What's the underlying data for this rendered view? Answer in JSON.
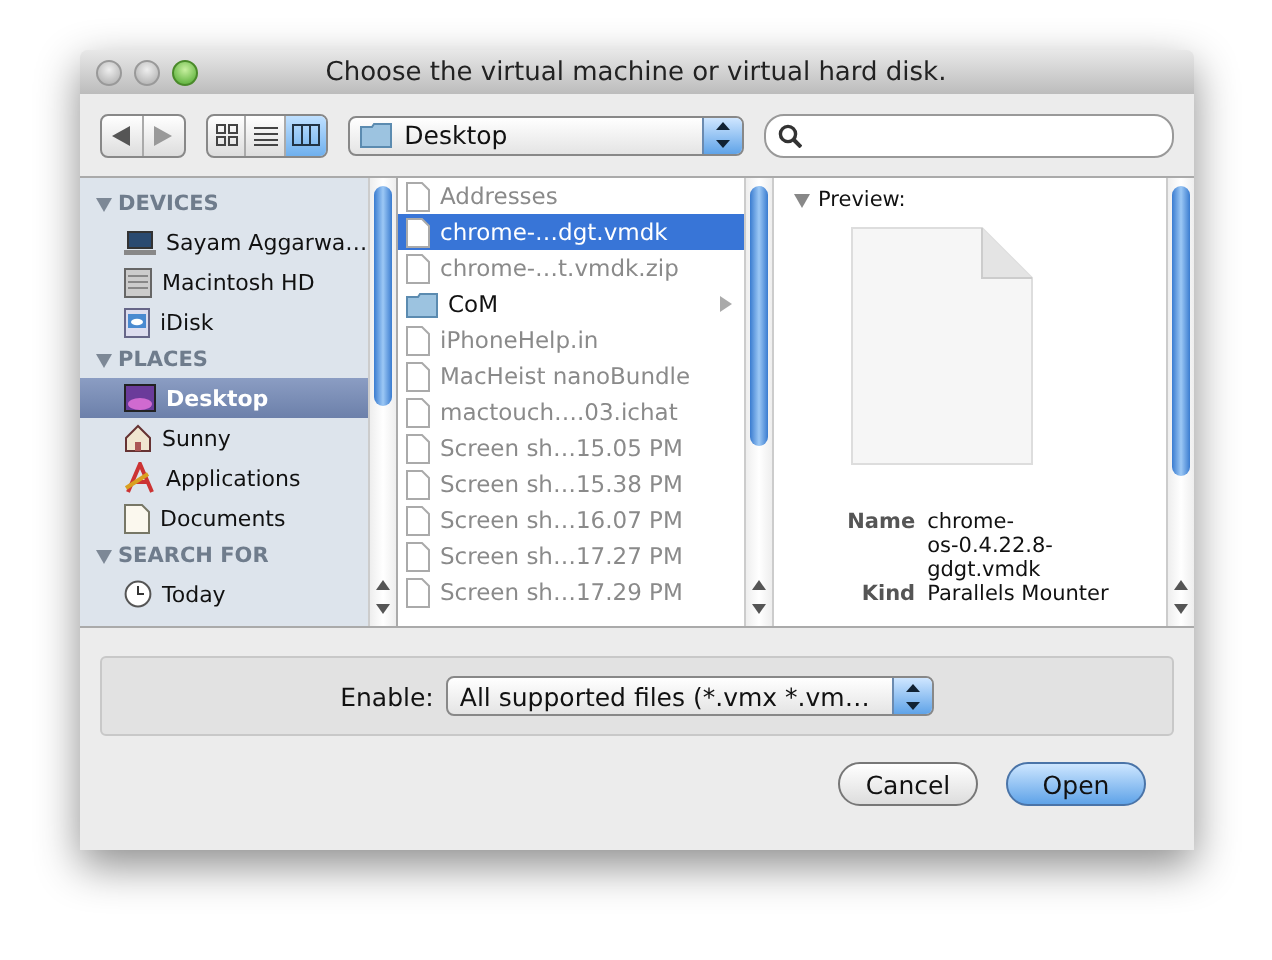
{
  "window": {
    "title": "Choose the virtual machine or virtual hard disk."
  },
  "toolbar": {
    "view_modes": [
      {
        "kind": "icon",
        "selected": false
      },
      {
        "kind": "list",
        "selected": false
      },
      {
        "kind": "column",
        "selected": true
      }
    ],
    "location": "Desktop"
  },
  "sidebar": {
    "sections": [
      {
        "heading": "DEVICES",
        "items": [
          {
            "label": "Sayam Aggarwa…",
            "kind": "laptop",
            "selected": false
          },
          {
            "label": "Macintosh HD",
            "kind": "drive",
            "selected": false
          },
          {
            "label": "iDisk",
            "kind": "idisk",
            "selected": false
          }
        ]
      },
      {
        "heading": "PLACES",
        "items": [
          {
            "label": "Desktop",
            "kind": "desktop",
            "selected": true
          },
          {
            "label": "Sunny",
            "kind": "home",
            "selected": false
          },
          {
            "label": "Applications",
            "kind": "apps",
            "selected": false
          },
          {
            "label": "Documents",
            "kind": "documents",
            "selected": false
          }
        ]
      },
      {
        "heading": "SEARCH FOR",
        "items": [
          {
            "label": "Today",
            "kind": "clock",
            "selected": false
          }
        ]
      }
    ]
  },
  "files": [
    {
      "name": "Addresses",
      "kind": "file",
      "disabled": true,
      "selected": false
    },
    {
      "name": "chrome-…dgt.vmdk",
      "kind": "file",
      "disabled": false,
      "selected": true
    },
    {
      "name": "chrome-…t.vmdk.zip",
      "kind": "file",
      "disabled": true,
      "selected": false
    },
    {
      "name": "CoM",
      "kind": "folder",
      "disabled": false,
      "selected": false
    },
    {
      "name": "iPhoneHelp.in",
      "kind": "file",
      "disabled": true,
      "selected": false
    },
    {
      "name": "MacHeist nanoBundle",
      "kind": "file",
      "disabled": true,
      "selected": false
    },
    {
      "name": "mactouch….03.ichat",
      "kind": "file",
      "disabled": true,
      "selected": false
    },
    {
      "name": "Screen sh…15.05 PM",
      "kind": "file",
      "disabled": true,
      "selected": false
    },
    {
      "name": "Screen sh…15.38 PM",
      "kind": "file",
      "disabled": true,
      "selected": false
    },
    {
      "name": "Screen sh…16.07 PM",
      "kind": "file",
      "disabled": true,
      "selected": false
    },
    {
      "name": "Screen sh…17.27 PM",
      "kind": "file",
      "disabled": true,
      "selected": false
    },
    {
      "name": "Screen sh…17.29 PM",
      "kind": "file",
      "disabled": true,
      "selected": false
    }
  ],
  "preview": {
    "heading": "Preview:",
    "info": [
      {
        "label": "Name",
        "value": "chrome-\nos-0.4.22.8-\ngdgt.vmdk"
      },
      {
        "label": "Kind",
        "value": "Parallels Mounter"
      }
    ]
  },
  "filter": {
    "label": "Enable:",
    "value": "All supported files (*.vmx *.vm…"
  },
  "buttons": [
    {
      "label": "Cancel",
      "default": false
    },
    {
      "label": "Open",
      "default": true
    }
  ]
}
